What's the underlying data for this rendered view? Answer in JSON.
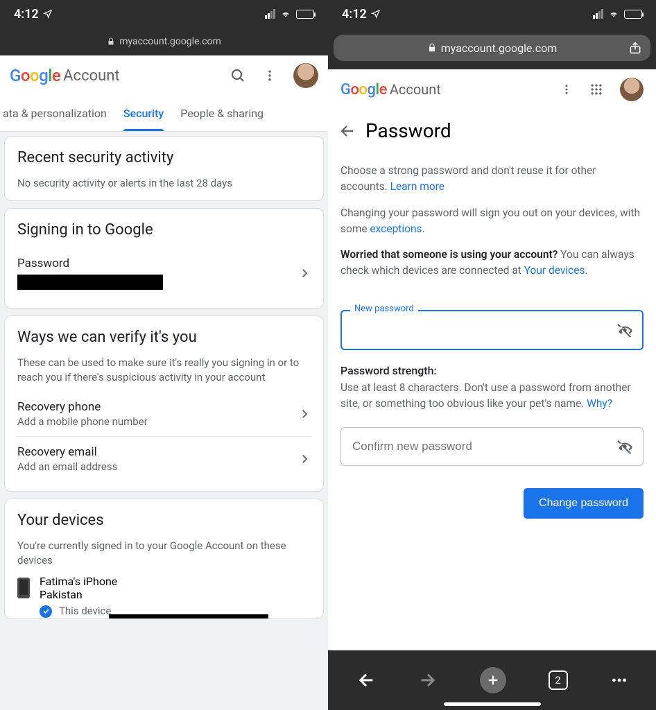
{
  "status": {
    "time": "4:12",
    "url": "myaccount.google.com"
  },
  "left": {
    "logo": "Google",
    "accountWord": "Account",
    "tabs": {
      "data": "ata & personalization",
      "security": "Security",
      "people": "People & sharing"
    },
    "recent": {
      "title": "Recent security activity",
      "body": "No security activity or alerts in the last 28 days"
    },
    "signin": {
      "title": "Signing in to Google",
      "password": "Password"
    },
    "verify": {
      "title": "Ways we can verify it's you",
      "body": "These can be used to make sure it's really you signing in or to reach you if there's suspicious activity in your account",
      "recoveryPhone": "Recovery phone",
      "recoveryPhoneSub": "Add a mobile phone number",
      "recoveryEmail": "Recovery email",
      "recoveryEmailSub": "Add an email address"
    },
    "devices": {
      "title": "Your devices",
      "body": "You're currently signed in to your Google Account on these devices",
      "deviceName": "Fatima's iPhone",
      "deviceLoc": "Pakistan",
      "thisDevice": "This device"
    }
  },
  "right": {
    "title": "Password",
    "p1a": "Choose a strong password and don't reuse it for other accounts. ",
    "learnMore": "Learn more",
    "p2a": "Changing your password will sign you out on your devices, with some ",
    "exceptions": "exceptions",
    "worried": "Worried that someone is using your account?",
    "p3a": " You can always check which devices are connected at ",
    "yourDevices": "Your devices",
    "newPassword": "New password",
    "strengthTitle": "Password strength:",
    "strengthBody": "Use at least 8 characters. Don't use a password from another site, or something too obvious like your pet's name. ",
    "why": "Why?",
    "confirm": "Confirm new password",
    "changeBtn": "Change password",
    "tabCount": "2"
  }
}
